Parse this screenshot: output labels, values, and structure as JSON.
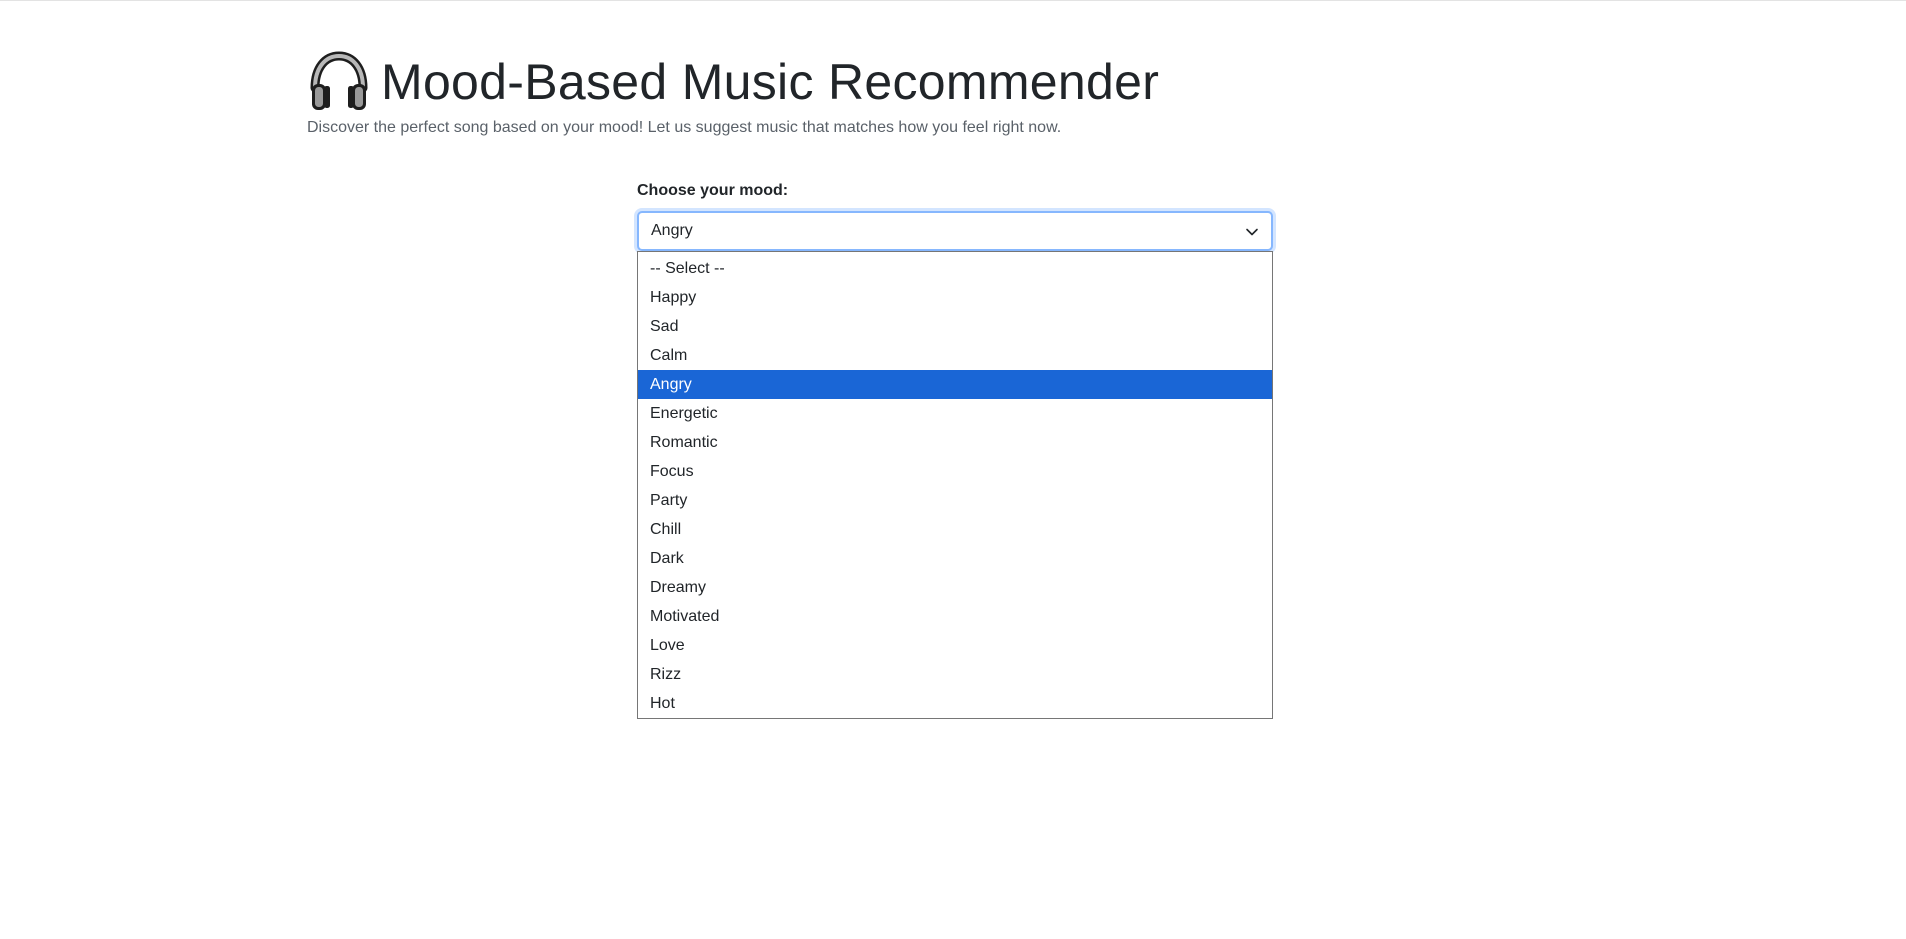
{
  "header": {
    "title": "Mood-Based Music Recommender",
    "subtitle": "Discover the perfect song based on your mood! Let us suggest music that matches how you feel right now.",
    "icon": "headphones-icon"
  },
  "mood_form": {
    "label": "Choose your mood:",
    "selected_value": "Angry",
    "options": [
      "-- Select --",
      "Happy",
      "Sad",
      "Calm",
      "Angry",
      "Energetic",
      "Romantic",
      "Focus",
      "Party",
      "Chill",
      "Dark",
      "Dreamy",
      "Motivated",
      "Love",
      "Rizz",
      "Hot"
    ],
    "selected_index": 4
  },
  "colors": {
    "highlight": "#1a66d6",
    "focus_border": "#86b7fe",
    "text": "#212529",
    "muted_text": "#5a6169"
  }
}
